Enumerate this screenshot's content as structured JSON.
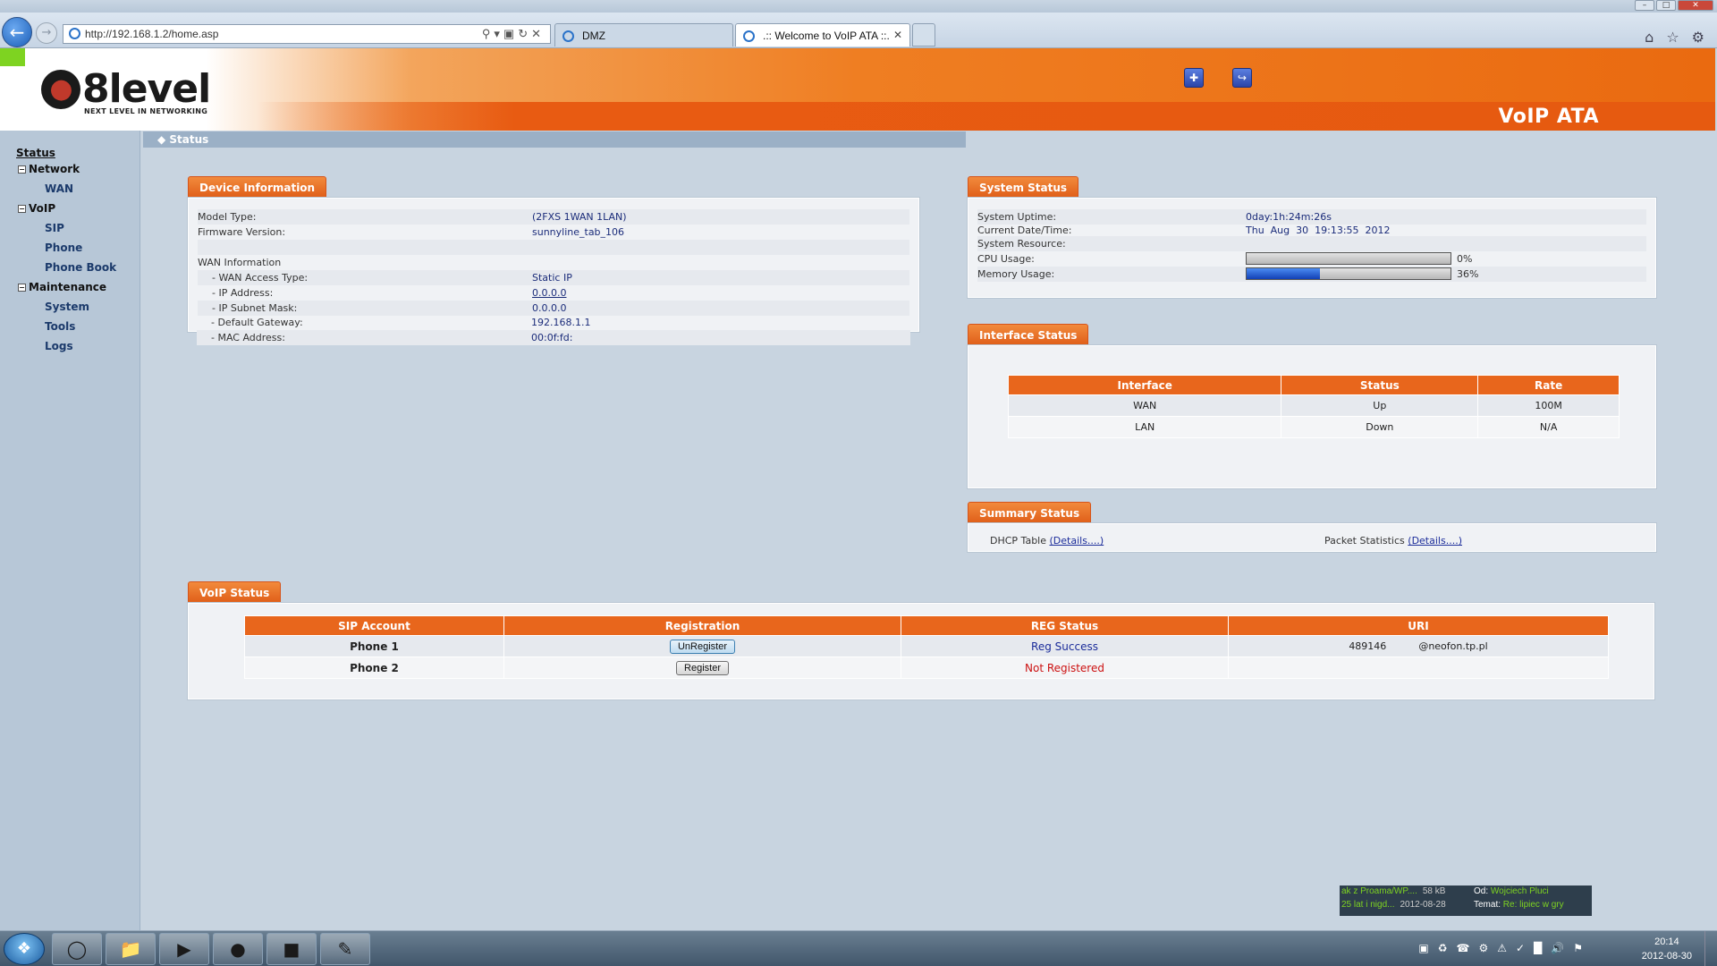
{
  "browser": {
    "url": "http://192.168.1.2/home.asp",
    "tabs": [
      {
        "label": "DMZ"
      },
      {
        "label": ".:: Welcome to VoIP ATA ::."
      }
    ],
    "window_buttons": [
      "–",
      "□",
      "✕"
    ],
    "nav_icons": [
      "home-icon",
      "star-icon",
      "gear-icon"
    ]
  },
  "header": {
    "logo_text": "8level",
    "tagline": "NEXT LEVEL IN NETWORKING",
    "product": "VoIP ATA",
    "brand_color": "#e8661c"
  },
  "breadcrumb": "Status",
  "sidebar": {
    "items": [
      {
        "label": "Status"
      },
      {
        "label": "Network"
      },
      {
        "label": "WAN"
      },
      {
        "label": "VoIP"
      },
      {
        "label": "SIP"
      },
      {
        "label": "Phone"
      },
      {
        "label": "Phone Book"
      },
      {
        "label": "Maintenance"
      },
      {
        "label": "System"
      },
      {
        "label": "Tools"
      },
      {
        "label": "Logs"
      }
    ]
  },
  "device_info": {
    "title": "Device Information",
    "model_label": "Model Type:",
    "model_value": "(2FXS 1WAN 1LAN)",
    "firmware_label": "Firmware Version:",
    "firmware_value": "sunnyline_tab_106",
    "wan_info_label": "WAN Information",
    "wan_type_label": "- WAN Access Type:",
    "wan_type_value": "Static IP",
    "ip_label": "- IP Address:",
    "ip_value": "0.0.0.0",
    "mask_label": "- IP Subnet Mask:",
    "mask_value": "0.0.0.0",
    "gateway_label": "- Default Gateway:",
    "gateway_value": "192.168.1.1",
    "mac_label": "- MAC Address:",
    "mac_value": "00:0f:fd:"
  },
  "system_status": {
    "title": "System Status",
    "uptime_label": "System Uptime:",
    "uptime_value": "0day:1h:24m:26s",
    "datetime_label": "Current Date/Time:",
    "datetime_value": "Thu  Aug  30  19:13:55  2012",
    "resource_label": "System Resource:",
    "cpu_label": "CPU Usage:",
    "cpu_pct": 0,
    "cpu_text": "0%",
    "mem_label": "Memory Usage:",
    "mem_pct": 36,
    "mem_text": "36%"
  },
  "interface_status": {
    "title": "Interface Status",
    "headers": [
      "Interface",
      "Status",
      "Rate"
    ],
    "rows": [
      [
        "WAN",
        "Up",
        "100M"
      ],
      [
        "LAN",
        "Down",
        "N/A"
      ]
    ]
  },
  "summary_status": {
    "title": "Summary Status",
    "dhcp_label": "DHCP Table",
    "dhcp_link": "(Details....)",
    "packet_label": "Packet Statistics",
    "packet_link": "(Details....)"
  },
  "voip_status": {
    "title": "VoIP Status",
    "headers": [
      "SIP Account",
      "Registration",
      "REG Status",
      "URI"
    ],
    "rows": [
      {
        "account": "Phone 1",
        "button": "UnRegister",
        "status": "Reg Success",
        "status_color": "#1b2c9a",
        "uri_a": "489146",
        "uri_b": "@neofon.tp.pl"
      },
      {
        "account": "Phone 2",
        "button": "Register",
        "status": "Not Registered",
        "status_color": "#cc1111",
        "uri_a": "",
        "uri_b": ""
      }
    ]
  },
  "notification": {
    "line1_left": "ak z Proama/WP....",
    "line1_size": "58 kB",
    "line2_left": "25 lat i nigd...",
    "line2_date": "2012-08-28",
    "from_label": "Od:",
    "from_value": "Wojciech Pluci",
    "subject_label": "Temat:",
    "subject_value": "Re: lipiec w gry"
  },
  "taskbar": {
    "time": "20:14",
    "date": "2012-08-30"
  }
}
